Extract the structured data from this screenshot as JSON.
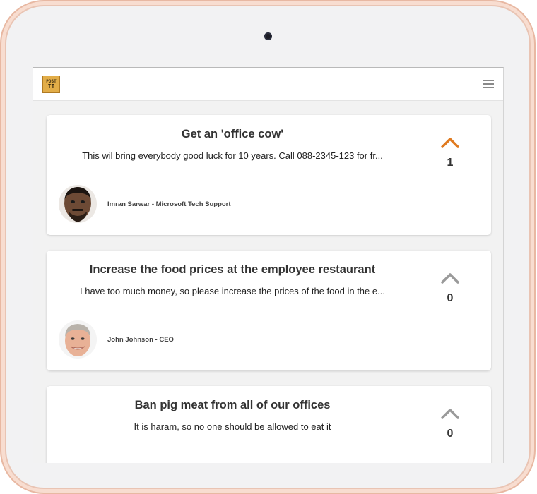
{
  "app": {
    "logo_text_top": "POST",
    "logo_text_bottom": "IT"
  },
  "colors": {
    "upvoted": "#e07a1f",
    "neutral": "#9a9a9a"
  },
  "posts": [
    {
      "title": "Get an 'office cow'",
      "description": "This wil bring everybody good luck for 10 years. Call 088-2345-123 for fr...",
      "author": "Imran Sarwar - Microsoft Tech Support",
      "votes": "1",
      "upvoted": true
    },
    {
      "title": "Increase the food prices at the employee restaurant",
      "description": "I have too much money, so please increase the prices of the food in the e...",
      "author": "John Johnson - CEO",
      "votes": "0",
      "upvoted": false
    },
    {
      "title": "Ban pig meat from all of our offices",
      "description": "It is haram, so no one should be allowed to eat it",
      "author": "",
      "votes": "0",
      "upvoted": false
    }
  ]
}
